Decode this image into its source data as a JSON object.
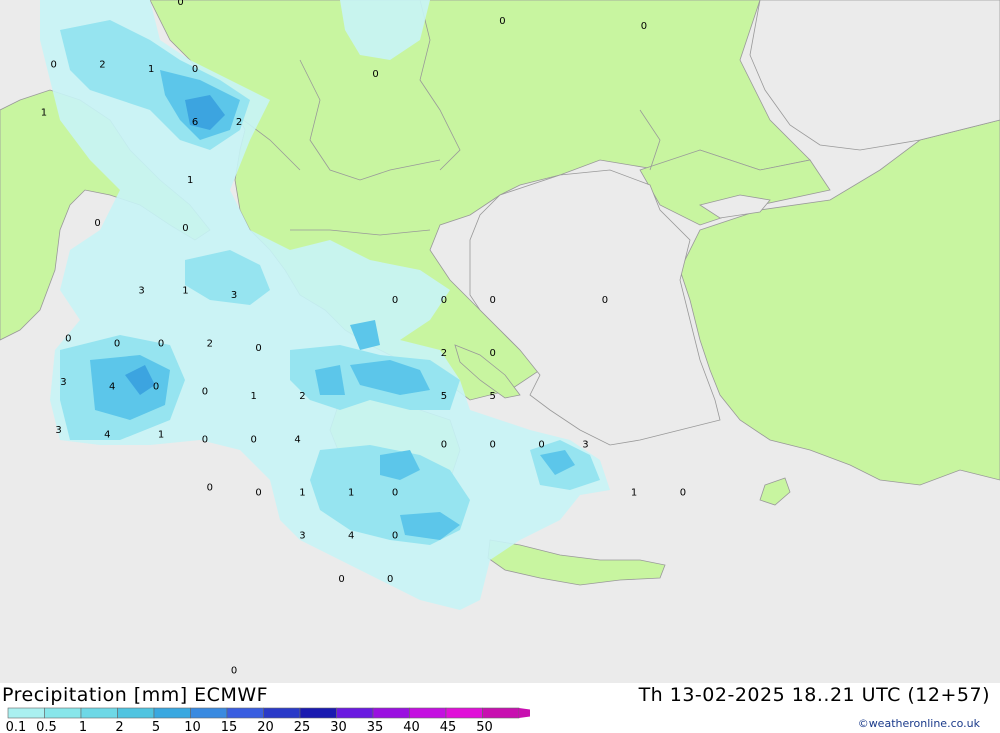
{
  "title": {
    "left": "Precipitation [mm] ECMWF",
    "right": "Th 13-02-2025 18..21 UTC (12+57)"
  },
  "credit": "©weatheronline.co.uk",
  "legend": {
    "labels": [
      "0.1",
      "0.5",
      "1",
      "2",
      "5",
      "10",
      "15",
      "20",
      "25",
      "30",
      "35",
      "40",
      "45",
      "50"
    ],
    "colors": [
      "#aaf0f0",
      "#88e6ea",
      "#6ed8e6",
      "#50c4e0",
      "#3aa8e0",
      "#3a8ae0",
      "#3a5ee0",
      "#2a3ac8",
      "#1a1ab0",
      "#6a1ae0",
      "#9a10e0",
      "#c410e0",
      "#e010d8",
      "#c810b0"
    ]
  },
  "colors": {
    "sea": "#ebebeb",
    "land": "#c8f5a0",
    "border": "#999999",
    "precip_light": "#c8f4f6",
    "precip_mid": "#96e4f0",
    "precip_heavy": "#5cc6ea",
    "precip_core": "#3ca4e0"
  },
  "map_labels": [
    {
      "text": "0",
      "lng": 15.7,
      "lat": 46.2
    },
    {
      "text": "0",
      "lng": 22.3,
      "lat": 45.8
    },
    {
      "text": "0",
      "lng": 25.2,
      "lat": 45.7
    },
    {
      "text": "0",
      "lng": 13.1,
      "lat": 44.9
    },
    {
      "text": "2",
      "lng": 14.1,
      "lat": 44.9
    },
    {
      "text": "1",
      "lng": 15.1,
      "lat": 44.8
    },
    {
      "text": "0",
      "lng": 16.0,
      "lat": 44.8
    },
    {
      "text": "0",
      "lng": 19.7,
      "lat": 44.7
    },
    {
      "text": "1",
      "lng": 12.9,
      "lat": 43.9
    },
    {
      "text": "6",
      "lng": 16.0,
      "lat": 43.7
    },
    {
      "text": "2",
      "lng": 16.9,
      "lat": 43.7
    },
    {
      "text": "1",
      "lng": 15.9,
      "lat": 42.5
    },
    {
      "text": "0",
      "lng": 14.0,
      "lat": 41.6
    },
    {
      "text": "0",
      "lng": 15.8,
      "lat": 41.5
    },
    {
      "text": "3",
      "lng": 14.9,
      "lat": 40.2
    },
    {
      "text": "1",
      "lng": 15.8,
      "lat": 40.2
    },
    {
      "text": "3",
      "lng": 16.8,
      "lat": 40.1
    },
    {
      "text": "0",
      "lng": 20.1,
      "lat": 40.0
    },
    {
      "text": "0",
      "lng": 21.1,
      "lat": 40.0
    },
    {
      "text": "0",
      "lng": 22.1,
      "lat": 40.0
    },
    {
      "text": "0",
      "lng": 24.4,
      "lat": 40.0
    },
    {
      "text": "0",
      "lng": 13.4,
      "lat": 39.2
    },
    {
      "text": "0",
      "lng": 14.4,
      "lat": 39.1
    },
    {
      "text": "0",
      "lng": 15.3,
      "lat": 39.1
    },
    {
      "text": "2",
      "lng": 16.3,
      "lat": 39.1
    },
    {
      "text": "0",
      "lng": 17.3,
      "lat": 39.0
    },
    {
      "text": "2",
      "lng": 21.1,
      "lat": 38.9
    },
    {
      "text": "0",
      "lng": 22.1,
      "lat": 38.9
    },
    {
      "text": "3",
      "lng": 13.3,
      "lat": 38.3
    },
    {
      "text": "4",
      "lng": 14.3,
      "lat": 38.2
    },
    {
      "text": "0",
      "lng": 15.2,
      "lat": 38.2
    },
    {
      "text": "0",
      "lng": 16.2,
      "lat": 38.1
    },
    {
      "text": "1",
      "lng": 17.2,
      "lat": 38.0
    },
    {
      "text": "2",
      "lng": 18.2,
      "lat": 38.0
    },
    {
      "text": "5",
      "lng": 21.1,
      "lat": 38.0
    },
    {
      "text": "5",
      "lng": 22.1,
      "lat": 38.0
    },
    {
      "text": "3",
      "lng": 13.2,
      "lat": 37.3
    },
    {
      "text": "4",
      "lng": 14.2,
      "lat": 37.2
    },
    {
      "text": "1",
      "lng": 15.3,
      "lat": 37.2
    },
    {
      "text": "0",
      "lng": 16.2,
      "lat": 37.1
    },
    {
      "text": "0",
      "lng": 17.2,
      "lat": 37.1
    },
    {
      "text": "4",
      "lng": 18.1,
      "lat": 37.1
    },
    {
      "text": "0",
      "lng": 21.1,
      "lat": 37.0
    },
    {
      "text": "0",
      "lng": 22.1,
      "lat": 37.0
    },
    {
      "text": "0",
      "lng": 23.1,
      "lat": 37.0
    },
    {
      "text": "3",
      "lng": 24.0,
      "lat": 37.0
    },
    {
      "text": "0",
      "lng": 16.3,
      "lat": 36.1
    },
    {
      "text": "0",
      "lng": 17.3,
      "lat": 36.0
    },
    {
      "text": "1",
      "lng": 18.2,
      "lat": 36.0
    },
    {
      "text": "1",
      "lng": 19.2,
      "lat": 36.0
    },
    {
      "text": "0",
      "lng": 20.1,
      "lat": 36.0
    },
    {
      "text": "1",
      "lng": 25.0,
      "lat": 36.0
    },
    {
      "text": "0",
      "lng": 26.0,
      "lat": 36.0
    },
    {
      "text": "3",
      "lng": 18.2,
      "lat": 35.1
    },
    {
      "text": "4",
      "lng": 19.2,
      "lat": 35.1
    },
    {
      "text": "0",
      "lng": 20.1,
      "lat": 35.1
    },
    {
      "text": "0",
      "lng": 19.0,
      "lat": 34.2
    },
    {
      "text": "0",
      "lng": 20.0,
      "lat": 34.2
    },
    {
      "text": "0",
      "lng": 16.8,
      "lat": 32.3
    }
  ]
}
